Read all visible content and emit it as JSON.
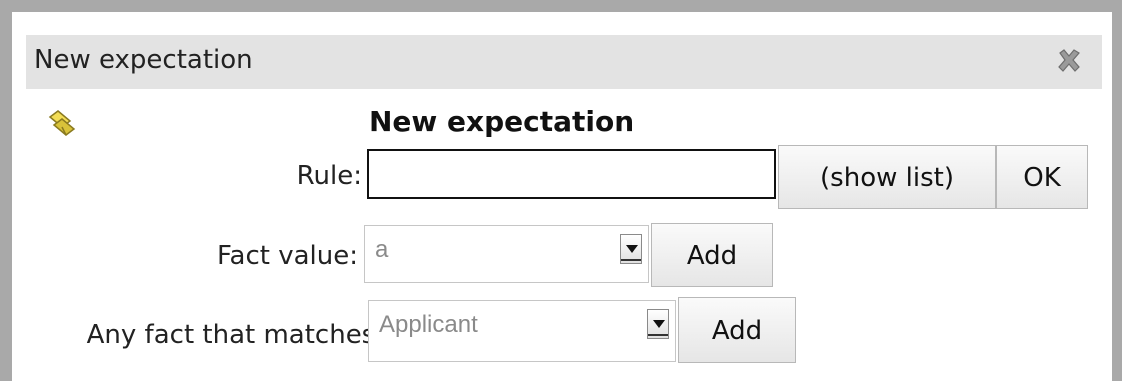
{
  "dialog": {
    "title": "New expectation",
    "close_icon": "close-x-icon"
  },
  "form": {
    "icon": "rule-scroll-icon",
    "heading": "New expectation",
    "rule": {
      "label": "Rule:",
      "value": "",
      "show_list_label": "(show list)",
      "ok_label": "OK"
    },
    "fact_value": {
      "label": "Fact value:",
      "selected": "a",
      "add_label": "Add"
    },
    "any_fact": {
      "label": "Any fact that matches:",
      "selected": "Applicant",
      "add_label": "Add"
    }
  }
}
